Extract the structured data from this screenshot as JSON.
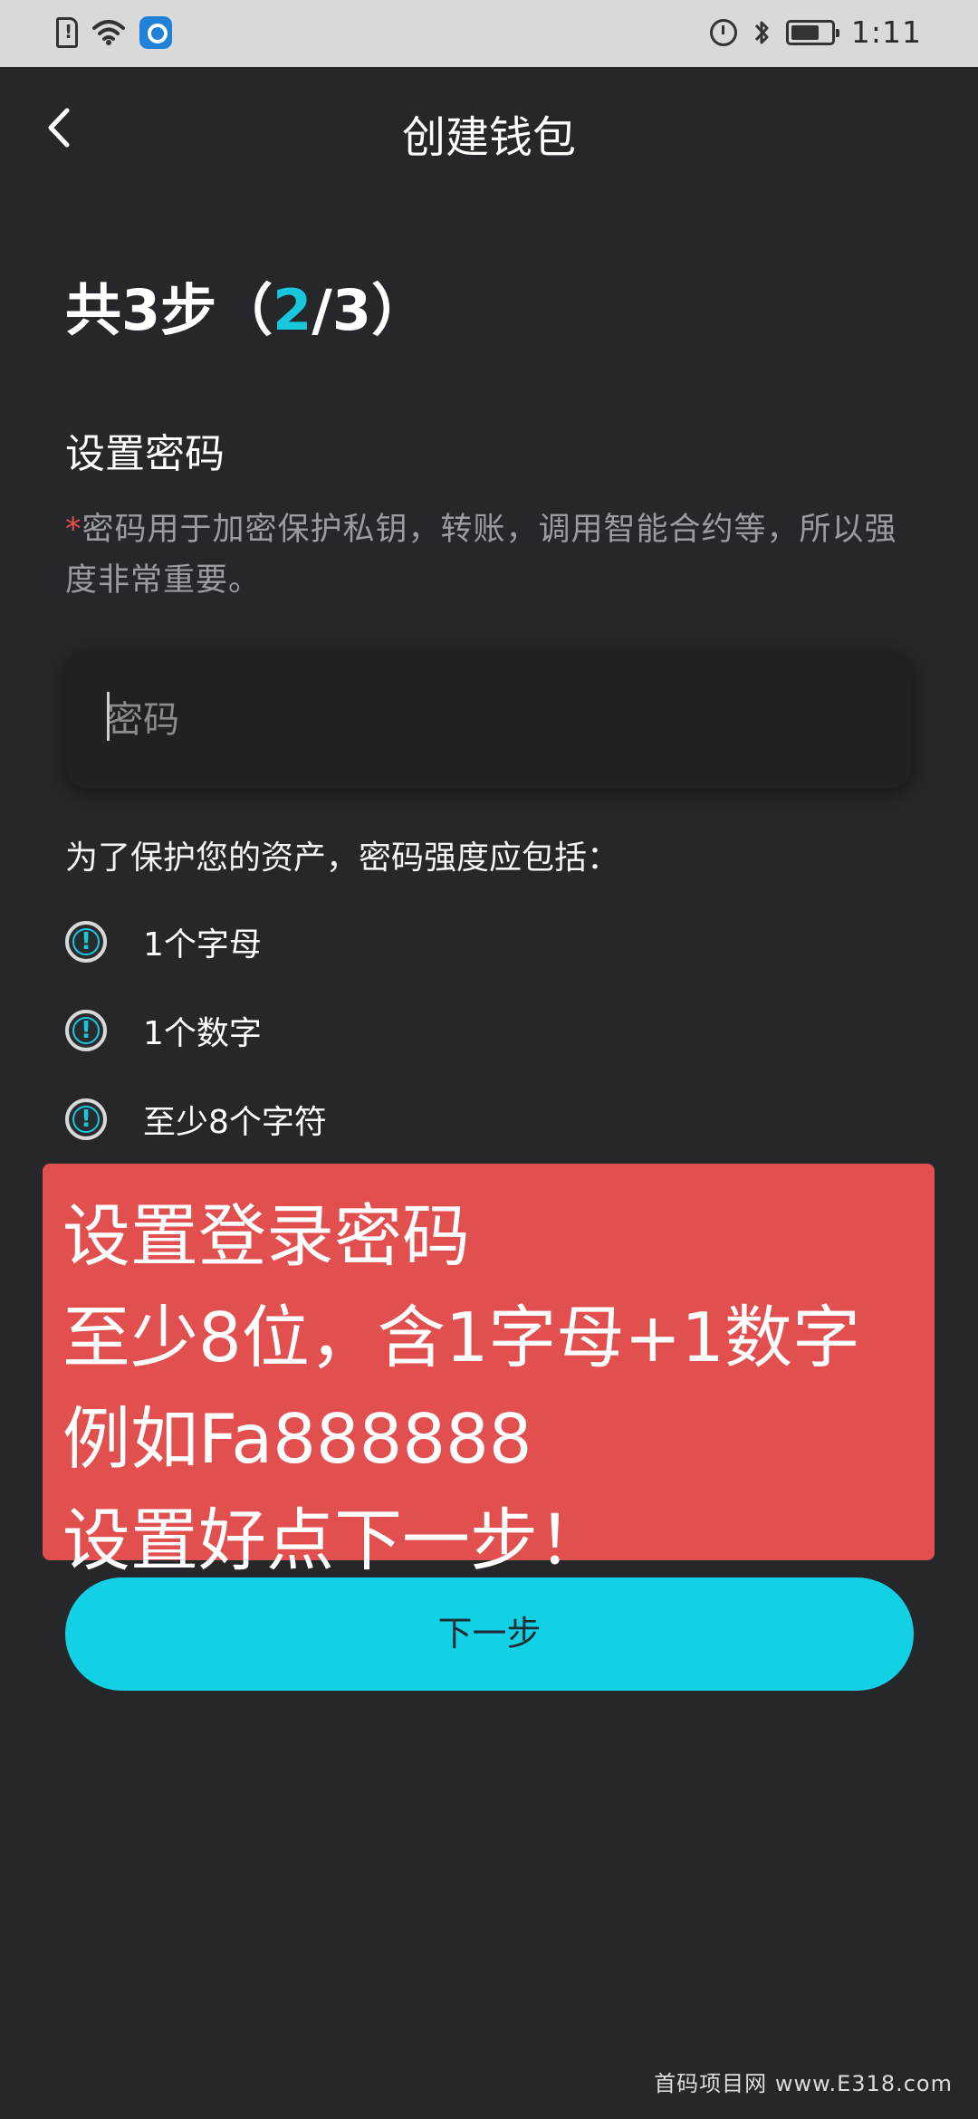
{
  "status_bar": {
    "time": "1:11",
    "icons": [
      "sim-alert-icon",
      "wifi-icon",
      "app-notification-icon",
      "alarm-icon",
      "bluetooth-icon",
      "battery-icon"
    ]
  },
  "header": {
    "title": "创建钱包",
    "back_icon": "chevron-left-icon"
  },
  "steps": {
    "prefix": "共3步（",
    "current": "2",
    "suffix": "/3）"
  },
  "section": {
    "title": "设置密码",
    "description_star": "*",
    "description": "密码用于加密保护私钥，转账，调用智能合约等，所以强度非常重要。"
  },
  "password_field": {
    "placeholder": "密码",
    "value": ""
  },
  "requirements": {
    "title": "为了保护您的资产，密码强度应包括：",
    "items": [
      "1个字母",
      "1个数字",
      "至少8个字符"
    ],
    "icon": "warning-icon"
  },
  "overlay_note": {
    "lines": [
      "设置登录密码",
      "至少8位，含1字母+1数字",
      "例如Fa888888",
      "设置好点下一步！"
    ],
    "color": "#e14f4f"
  },
  "actions": {
    "next_label": "下一步",
    "accent_color": "#13d1e4"
  },
  "watermark": "首码项目网 www.E318.com"
}
